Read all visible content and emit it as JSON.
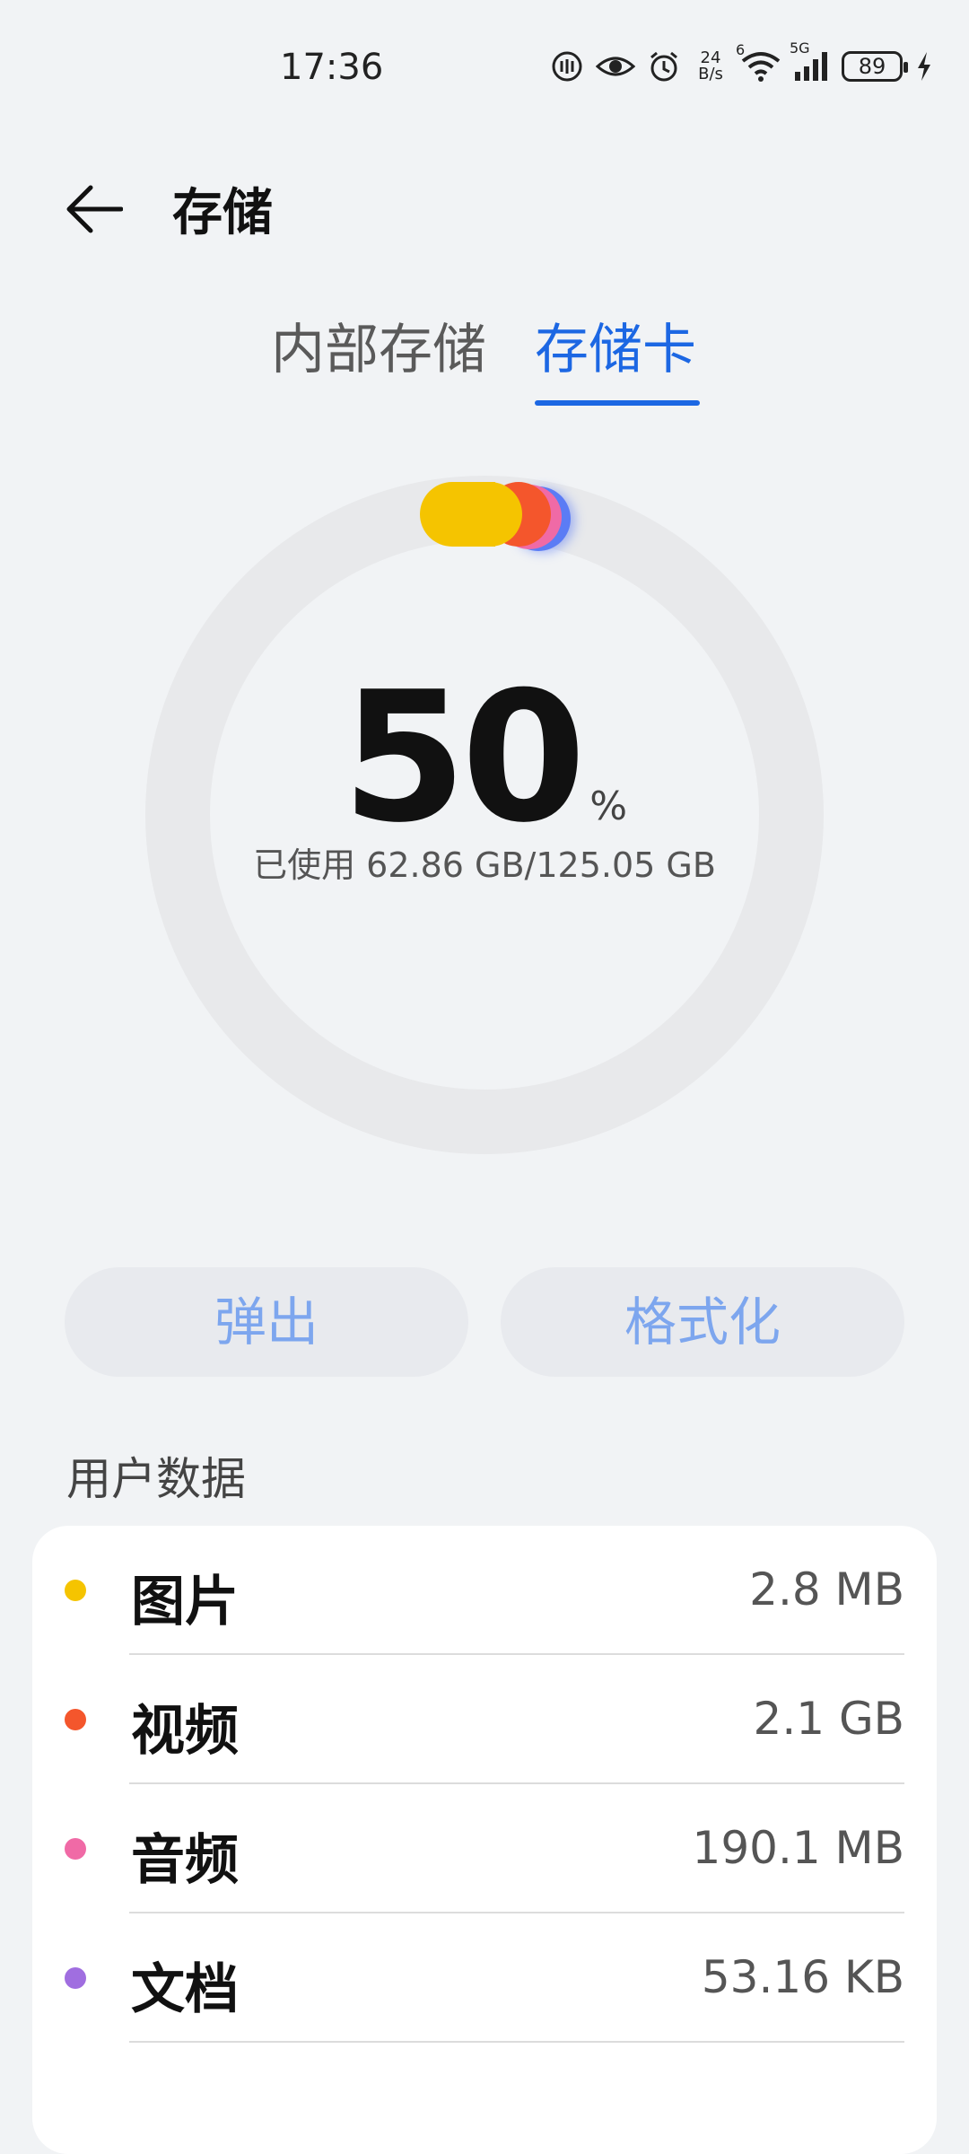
{
  "status_bar": {
    "time": "17:36",
    "net_speed_value": "24",
    "net_speed_unit": "B/s",
    "wifi_badge": "6",
    "cell_badge": "5G",
    "battery_level": "89"
  },
  "app_bar": {
    "title": "存储"
  },
  "tabs": [
    {
      "label": "内部存储",
      "selected": false
    },
    {
      "label": "存储卡",
      "selected": true
    }
  ],
  "usage": {
    "percent": "50",
    "percent_unit": "%",
    "detail": "已使用 62.86 GB/125.05 GB"
  },
  "actions": {
    "eject_label": "弹出",
    "format_label": "格式化"
  },
  "section_title": "用户数据",
  "categories": [
    {
      "label": "图片",
      "size": "2.8 MB",
      "color": "#f5c400"
    },
    {
      "label": "视频",
      "size": "2.1 GB",
      "color": "#f4562c"
    },
    {
      "label": "音频",
      "size": "190.1 MB",
      "color": "#f06aa6"
    },
    {
      "label": "文档",
      "size": "53.16 KB",
      "color": "#a06ee0"
    }
  ],
  "colors": {
    "accent": "#1c67e3",
    "ring_track": "#e8e9eb",
    "ring_blue": "#5b7cf5"
  }
}
